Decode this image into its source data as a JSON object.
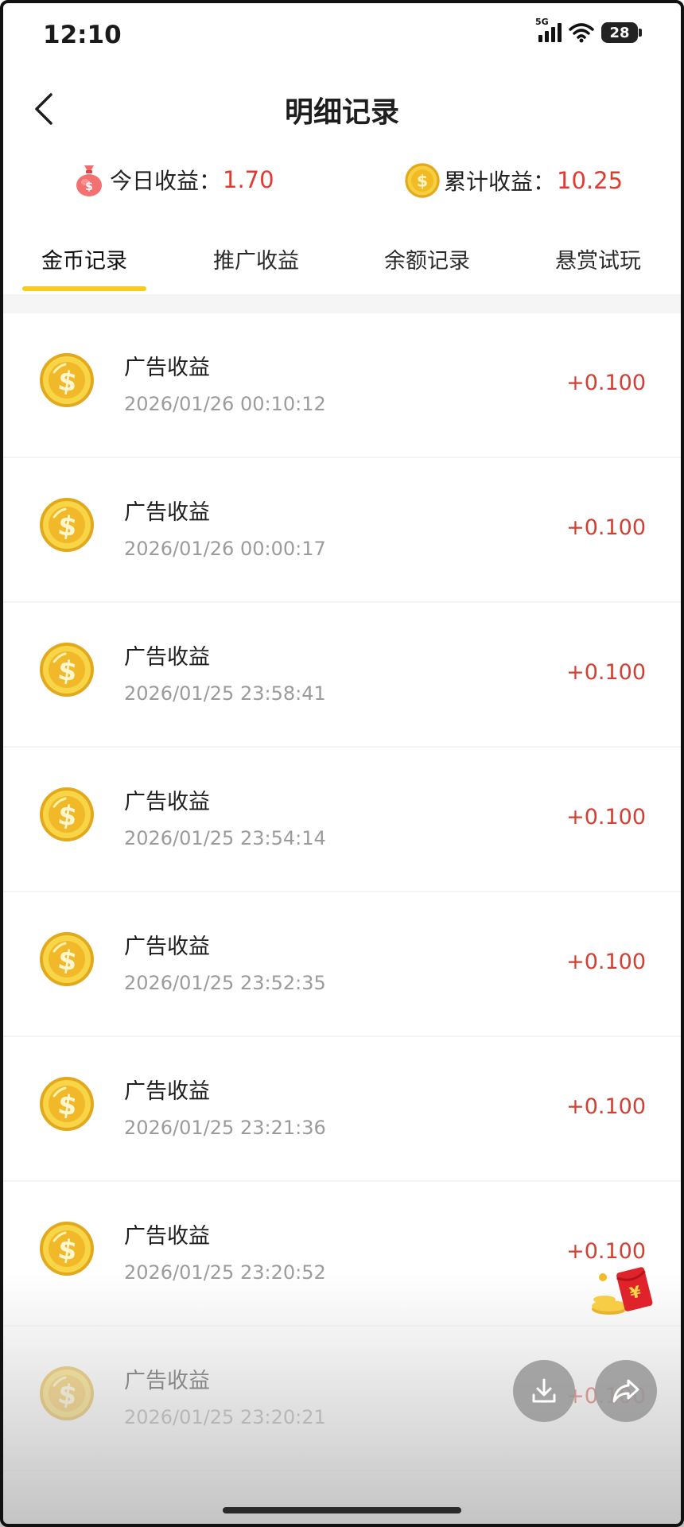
{
  "status_bar": {
    "time": "12:10",
    "network": "5G",
    "battery": "28"
  },
  "header": {
    "title": "明细记录",
    "back_icon": "chevron-left-icon"
  },
  "summary": {
    "today_label": "今日收益：",
    "today_value": "1.70",
    "total_label": "累计收益：",
    "total_value": "10.25"
  },
  "tabs": [
    {
      "label": "金币记录",
      "active": true
    },
    {
      "label": "推广收益",
      "active": false
    },
    {
      "label": "余额记录",
      "active": false
    },
    {
      "label": "悬赏试玩",
      "active": false
    }
  ],
  "records": [
    {
      "title": "广告收益",
      "time": "2026/01/26 00:10:12",
      "amount": "+0.100"
    },
    {
      "title": "广告收益",
      "time": "2026/01/26 00:00:17",
      "amount": "+0.100"
    },
    {
      "title": "广告收益",
      "time": "2026/01/25 23:58:41",
      "amount": "+0.100"
    },
    {
      "title": "广告收益",
      "time": "2026/01/25 23:54:14",
      "amount": "+0.100"
    },
    {
      "title": "广告收益",
      "time": "2026/01/25 23:52:35",
      "amount": "+0.100"
    },
    {
      "title": "广告收益",
      "time": "2026/01/25 23:21:36",
      "amount": "+0.100"
    },
    {
      "title": "广告收益",
      "time": "2026/01/25 23:20:52",
      "amount": "+0.100"
    },
    {
      "title": "广告收益",
      "time": "2026/01/25 23:20:21",
      "amount": "+0.100"
    }
  ],
  "colors": {
    "accent_yellow": "#f7cc1e",
    "amount_red": "#d24034",
    "summary_red": "#e23a30"
  },
  "icons": {
    "coin": "gold-coin-icon",
    "money_bag": "money-bag-icon",
    "red_packet": "red-packet-icon",
    "download": "download-icon",
    "share": "share-icon"
  }
}
